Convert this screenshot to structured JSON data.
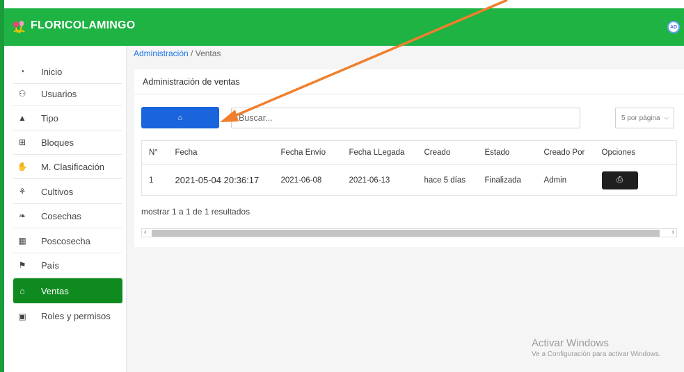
{
  "app": {
    "brand": "FLORICOLAMINGO",
    "avatar_initials": "AD",
    "accent": "#1eb343"
  },
  "sidebar": {
    "items": [
      {
        "label": "Inicio",
        "icon": "tachometer-icon",
        "glyph": "◔"
      },
      {
        "label": "Usuarios",
        "icon": "users-icon",
        "glyph": "⚇"
      },
      {
        "label": "Tipo",
        "icon": "tree-icon",
        "glyph": "▲"
      },
      {
        "label": "Bloques",
        "icon": "grid-icon",
        "glyph": "⊞"
      },
      {
        "label": "M. Clasificación",
        "icon": "hand-holding-icon",
        "glyph": "✋"
      },
      {
        "label": "Cultivos",
        "icon": "seedling-icon",
        "glyph": "⚘"
      },
      {
        "label": "Cosechas",
        "icon": "leaf-icon",
        "glyph": "❧"
      },
      {
        "label": "Poscosecha",
        "icon": "boxes-icon",
        "glyph": "▦"
      },
      {
        "label": "País",
        "icon": "flag-icon",
        "glyph": "⚑"
      },
      {
        "label": "Ventas",
        "icon": "cart-icon",
        "glyph": "⌂",
        "active": true
      },
      {
        "label": "Roles y permisos",
        "icon": "lock-icon",
        "glyph": "▣"
      }
    ]
  },
  "breadcrumb": {
    "parent": "Administración",
    "separator": "/",
    "current": "Ventas"
  },
  "card": {
    "title": "Administración de ventas"
  },
  "toolbar": {
    "cart_button_glyph": "⌂",
    "search_placeholder": "Buscar...",
    "per_page": "5 por página"
  },
  "table": {
    "headers": [
      "N°",
      "Fecha",
      "Fecha Envío",
      "Fecha LLegada",
      "Creado",
      "Estado",
      "Creado Por",
      "Opciones"
    ],
    "rows": [
      [
        "1",
        "2021-05-04 20:36:17",
        "2021-06-08",
        "2021-06-13",
        "hace 5 días",
        "Finalizada",
        "Admin"
      ]
    ],
    "print_glyph": "⎙"
  },
  "results_text": "mostrar 1 a 1 de 1 resultados",
  "watermark": {
    "line1": "Activar Windows",
    "line2": "Ve a Configuración para activar Windows."
  }
}
